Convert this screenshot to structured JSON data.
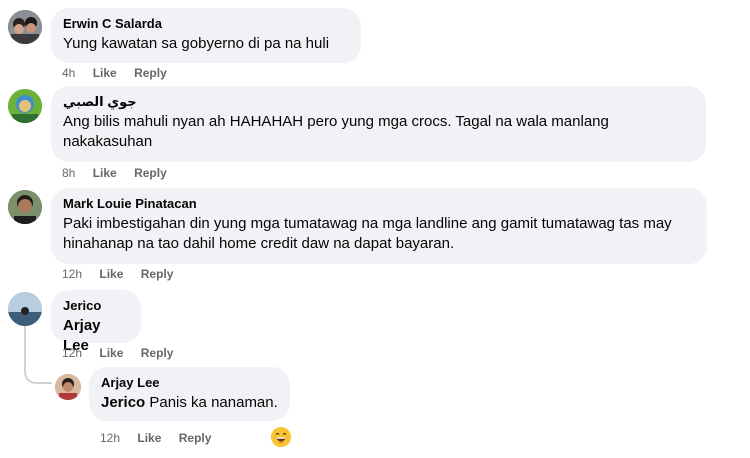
{
  "comments": [
    {
      "author": "Erwin C Salarda",
      "text": "Yung kawatan sa gobyerno di pa na huli",
      "time": "4h",
      "like": "Like",
      "reply": "Reply"
    },
    {
      "author": "جوي الصبي",
      "text": "Ang bilis mahuli nyan ah HAHAHAH pero yung mga crocs. Tagal na wala manlang nakakasuhan",
      "time": "8h",
      "like": "Like",
      "reply": "Reply"
    },
    {
      "author": "Mark Louie Pinatacan",
      "text": "Paki imbestigahan din yung mga tumatawag na mga landline ang gamit tumatawag tas may hinahanap na tao dahil home credit daw na dapat bayaran.",
      "time": "12h",
      "like": "Like",
      "reply": "Reply"
    },
    {
      "author": "Jerico",
      "mention": "Arjay Lee",
      "text": "",
      "time": "12h",
      "like": "Like",
      "reply": "Reply"
    },
    {
      "author": "Arjay Lee",
      "mention": "Jerico",
      "text": " Panis ka nanaman.",
      "time": "12h",
      "like": "Like",
      "reply": "Reply",
      "reaction_icon": "laughing-emoji-icon"
    }
  ],
  "colors": {
    "bubble": "#f0f2f5",
    "meta_text": "#65676b",
    "thread_line": "#ced0d4"
  }
}
